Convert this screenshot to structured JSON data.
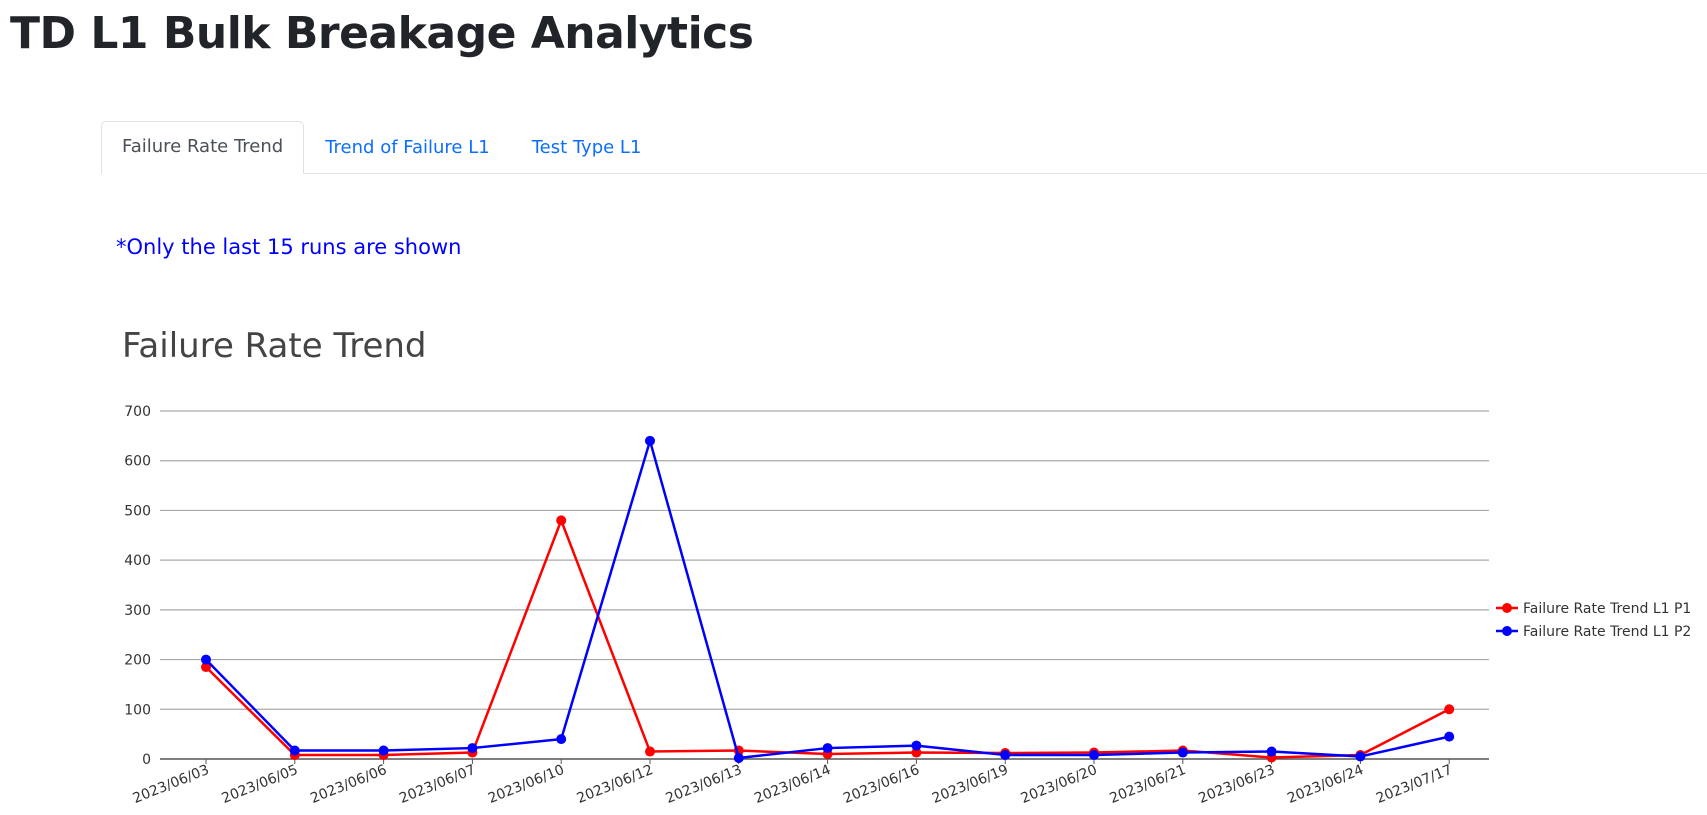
{
  "page": {
    "title": "TD L1 Bulk Breakage Analytics"
  },
  "tabs": [
    {
      "label": "Failure Rate Trend",
      "active": true
    },
    {
      "label": "Trend of Failure L1",
      "active": false
    },
    {
      "label": "Test Type L1",
      "active": false
    }
  ],
  "note": "*Only the last 15 runs are shown",
  "colors": {
    "series_p1": "#ff0000",
    "series_p2": "#0000ff",
    "tab_link": "#0d6efd",
    "note": "#0000ff"
  },
  "chart_data": {
    "type": "line",
    "title": "Failure Rate Trend",
    "xlabel": "",
    "ylabel": "",
    "ylim": [
      0,
      700
    ],
    "yticks": [
      0,
      100,
      200,
      300,
      400,
      500,
      600,
      700
    ],
    "grid": true,
    "legend_position": "right",
    "categories": [
      "2023/06/03",
      "2023/06/05",
      "2023/06/06",
      "2023/06/07",
      "2023/06/10",
      "2023/06/12",
      "2023/06/13",
      "2023/06/14",
      "2023/06/16",
      "2023/06/19",
      "2023/06/20",
      "2023/06/21",
      "2023/06/23",
      "2023/06/24",
      "2023/07/17"
    ],
    "series": [
      {
        "name": "Failure Rate Trend L1 P1",
        "color": "#ff0000",
        "values": [
          185,
          8,
          8,
          13,
          480,
          15,
          17,
          10,
          13,
          12,
          13,
          17,
          3,
          8,
          100
        ]
      },
      {
        "name": "Failure Rate Trend L1 P2",
        "color": "#0000ff",
        "values": [
          200,
          17,
          17,
          22,
          40,
          640,
          2,
          22,
          27,
          8,
          8,
          13,
          15,
          5,
          45
        ]
      }
    ]
  }
}
